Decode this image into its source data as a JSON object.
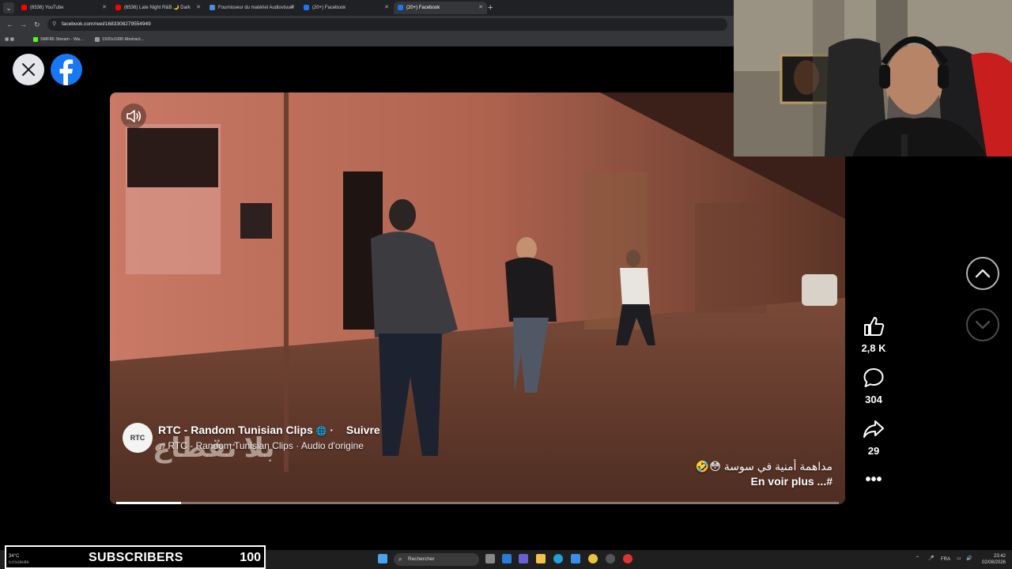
{
  "browser": {
    "tabs": [
      {
        "title": "(6536) YouTube",
        "color": "#ff0000"
      },
      {
        "title": "(6536) Late Night R&B 🌙 Dark",
        "color": "#ff0000"
      },
      {
        "title": "Fournisseur du matériel Audiovisuel",
        "color": "#4a90d9"
      },
      {
        "title": "(20+) Facebook",
        "color": "#1877f2"
      },
      {
        "title": "(20+) Facebook",
        "color": "#1877f2"
      }
    ],
    "url": "facebook.com/reel/1683308279554949",
    "bookmarks": [
      {
        "label": "SMF86 Stream - Wa...",
        "color": "#53fc18"
      },
      {
        "label": "1920x1080 Abstract...",
        "color": "#999999"
      }
    ]
  },
  "reel": {
    "author_initials": "RTC",
    "author_name": "RTC - Random Tunisian Clips",
    "follow_label": "Suivre",
    "audio_label": "RTC - Random Tunisian Clips · Audio d'origine",
    "caption": "مداهمة أمنية في سوسة 😳🤣",
    "see_more": "En voir plus ...#",
    "watermark_text": "بلا تقطاع",
    "progress": 0.09,
    "likes": "2,8 K",
    "comments": "304",
    "shares": "29"
  },
  "taskbar": {
    "weather_temp": "34°C",
    "weather_desc": "Ensoleillé",
    "search_placeholder": "Rechercher",
    "lang": "FRA",
    "time": "23:42",
    "date": "02/08/2026"
  },
  "overlay": {
    "subscribers_label": "SUBSCRIBERS",
    "subscribers_count": "100"
  }
}
